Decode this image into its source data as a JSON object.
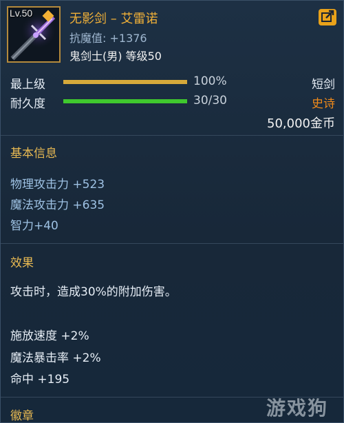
{
  "item": {
    "level": "Lv.50",
    "name": "无影剑 – 艾雷诺",
    "resist": "抗魔值: +1376",
    "class_level": "鬼剑士(男) 等级50"
  },
  "bars": {
    "upgrade": {
      "label": "最上级",
      "value": "100%",
      "fraction": 1.0,
      "color": "#d6a93a"
    },
    "durability": {
      "label": "耐久度",
      "value": "30/30",
      "fraction": 1.0,
      "color": "#3fc82e"
    }
  },
  "meta": {
    "type": "短剑",
    "rarity": "史诗",
    "rarity_color": "#f08a1a",
    "price": "50,000金币"
  },
  "basic_info": {
    "title": "基本信息",
    "stats": [
      "物理攻击力 +523",
      "魔法攻击力 +635",
      "智力+40"
    ]
  },
  "effects": {
    "title": "效果",
    "description": "攻击时，造成30%的附加伤害。",
    "stats": [
      "施放速度 +2%",
      "魔法暴击率 +2%",
      "命中 +195"
    ]
  },
  "badge_section": {
    "title": "徽章"
  },
  "icons": {
    "share": "share-export-icon",
    "weapon": "sword-icon"
  },
  "watermark": "游戏狗"
}
